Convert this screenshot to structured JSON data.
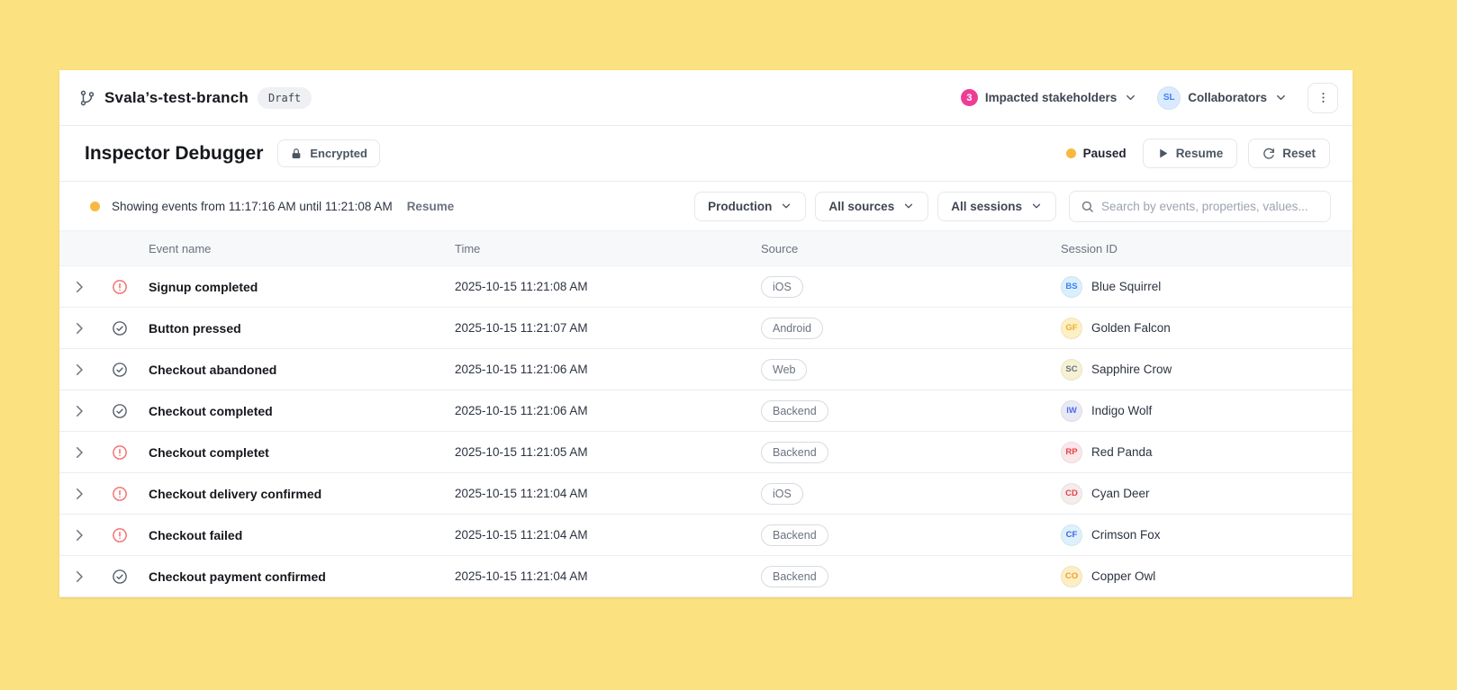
{
  "header": {
    "branch_name": "Svala’s-test-branch",
    "draft_badge": "Draft",
    "stakeholders_count": "3",
    "stakeholders_label": "Impacted stakeholders",
    "collaborators_avatar": "SL",
    "collaborators_label": "Collaborators"
  },
  "toolbar": {
    "title": "Inspector Debugger",
    "encrypted_label": "Encrypted",
    "status_label": "Paused",
    "resume_label": "Resume",
    "reset_label": "Reset"
  },
  "filters": {
    "showing_text": "Showing events from 11:17:16 AM until 11:21:08 AM",
    "resume_link": "Resume",
    "environment_value": "Production",
    "sources_value": "All sources",
    "sessions_value": "All sessions",
    "search_placeholder": "Search by events, properties, values..."
  },
  "colors": {
    "page_background": "#FCE181",
    "stakeholders_badge": "#EC3E95",
    "paused_dot": "#F7B941",
    "error_icon": "#F26D6D",
    "success_icon": "#525A66"
  },
  "table": {
    "columns": [
      "Event name",
      "Time",
      "Source",
      "Session ID"
    ],
    "rows": [
      {
        "status": "error",
        "event": "Signup completed",
        "time": "2025-10-15 11:21:08 AM",
        "source": "iOS",
        "initials": "BS",
        "session": "Blue Squirrel",
        "avatar_bg": "#DCEFFD",
        "avatar_fg": "#3B82F6"
      },
      {
        "status": "ok",
        "event": "Button pressed",
        "time": "2025-10-15 11:21:07 AM",
        "source": "Android",
        "initials": "GF",
        "session": "Golden Falcon",
        "avatar_bg": "#FDF0C5",
        "avatar_fg": "#EDAE2F"
      },
      {
        "status": "ok",
        "event": "Checkout abandoned",
        "time": "2025-10-15 11:21:06 AM",
        "source": "Web",
        "initials": "SC",
        "session": "Sapphire Crow",
        "avatar_bg": "#F6F1D3",
        "avatar_fg": "#64748B"
      },
      {
        "status": "ok",
        "event": "Checkout completed",
        "time": "2025-10-15 11:21:06 AM",
        "source": "Backend",
        "initials": "IW",
        "session": "Indigo Wolf",
        "avatar_bg": "#E9E9F3",
        "avatar_fg": "#4D6BF5"
      },
      {
        "status": "error",
        "event": "Checkout completet",
        "time": "2025-10-15 11:21:05 AM",
        "source": "Backend",
        "initials": "RP",
        "session": "Red Panda",
        "avatar_bg": "#F9E7E9",
        "avatar_fg": "#E8414B"
      },
      {
        "status": "error",
        "event": "Checkout delivery confirmed",
        "time": "2025-10-15 11:21:04 AM",
        "source": "iOS",
        "initials": "CD",
        "session": "Cyan Deer",
        "avatar_bg": "#F5ECEC",
        "avatar_fg": "#E8414B"
      },
      {
        "status": "error",
        "event": "Checkout failed",
        "time": "2025-10-15 11:21:04 AM",
        "source": "Backend",
        "initials": "CF",
        "session": "Crimson Fox",
        "avatar_bg": "#DCF1FB",
        "avatar_fg": "#4661E6"
      },
      {
        "status": "ok",
        "event": "Checkout payment confirmed",
        "time": "2025-10-15 11:21:04 AM",
        "source": "Backend",
        "initials": "CO",
        "session": "Copper Owl",
        "avatar_bg": "#FCEEC6",
        "avatar_fg": "#EFA12D"
      }
    ]
  }
}
